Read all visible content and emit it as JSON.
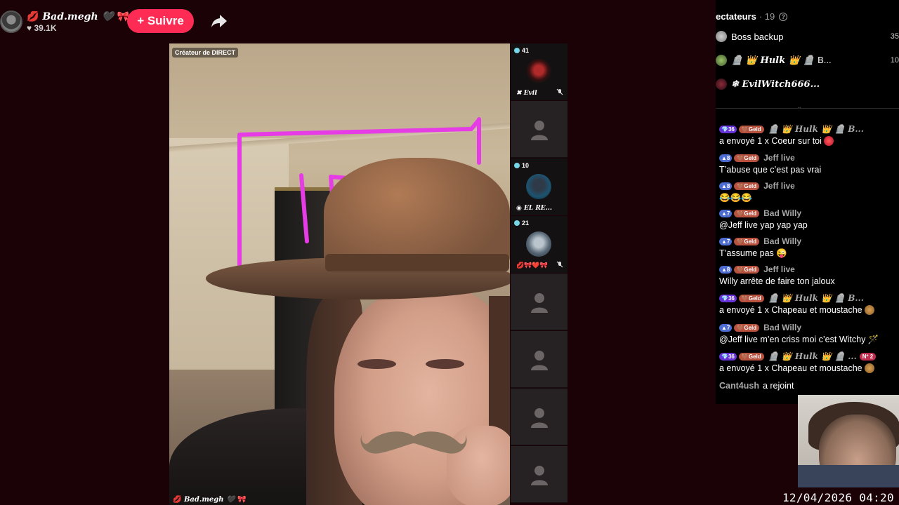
{
  "host": {
    "name": "Bad.megh",
    "likes": "39.1K",
    "follow_label": "+ Suivre"
  },
  "video": {
    "creator_badge": "Créateur de DIRECT",
    "caption": "Bad.megh"
  },
  "guests": [
    {
      "count": "41",
      "name": "Evil",
      "has_avatar": true
    },
    {
      "count": "",
      "name": "",
      "has_avatar": false
    },
    {
      "count": "10",
      "name": "EL RE...",
      "has_avatar": true
    },
    {
      "count": "21",
      "name": "",
      "has_avatar": true
    },
    {
      "count": "",
      "name": "",
      "has_avatar": false
    },
    {
      "count": "",
      "name": "",
      "has_avatar": false
    },
    {
      "count": "",
      "name": "",
      "has_avatar": false
    },
    {
      "count": "",
      "name": "",
      "has_avatar": false
    }
  ],
  "viewers": {
    "title": "ectateurs",
    "count": "· 19",
    "list": [
      {
        "name": "Boss backup",
        "score": "35"
      },
      {
        "name": "Hulk",
        "suffix": "B...",
        "score": "10"
      },
      {
        "name": "EvilWitch666...",
        "score": ""
      }
    ]
  },
  "chat": [
    {
      "level": "36",
      "level_color": "purple",
      "badge": "Geld",
      "user": "Hulk",
      "user_suffix": "B...",
      "text": "a envoyé 1 x Coeur sur toi"
    },
    {
      "level": "8",
      "level_color": "blue",
      "badge": "Geld",
      "user": "Jeff live",
      "text": "T’abuse que c’est pas vrai"
    },
    {
      "level": "8",
      "level_color": "blue",
      "badge": "Geld",
      "user": "Jeff live",
      "text": "😂😂😂"
    },
    {
      "level": "7",
      "level_color": "blue",
      "badge": "Geld",
      "user": "Bad Willy",
      "text": "@Jeff live yap yap yap"
    },
    {
      "level": "7",
      "level_color": "blue",
      "badge": "Geld",
      "user": "Bad Willy",
      "text": "T’assume pas 😜"
    },
    {
      "level": "8",
      "level_color": "blue",
      "badge": "Geld",
      "user": "Jeff live",
      "text": "Willy arrête de faire ton jaloux"
    },
    {
      "level": "36",
      "level_color": "purple",
      "badge": "Geld",
      "user": "Hulk",
      "user_suffix": "B...",
      "text": "a envoyé 1 x Chapeau et moustache"
    },
    {
      "level": "7",
      "level_color": "blue",
      "badge": "Geld",
      "user": "Bad Willy",
      "text": "@Jeff live m’en criss moi c’est Witchy"
    },
    {
      "level": "36",
      "level_color": "purple",
      "badge": "Geld",
      "user": "Hulk",
      "user_suffix": "...",
      "rank": "Nº 2",
      "text": "a envoyé 1 x Chapeau et moustache"
    }
  ],
  "join": {
    "user": "Cant4ush",
    "text": "a rejoint"
  },
  "timestamp": "12/04/2026 04:20"
}
